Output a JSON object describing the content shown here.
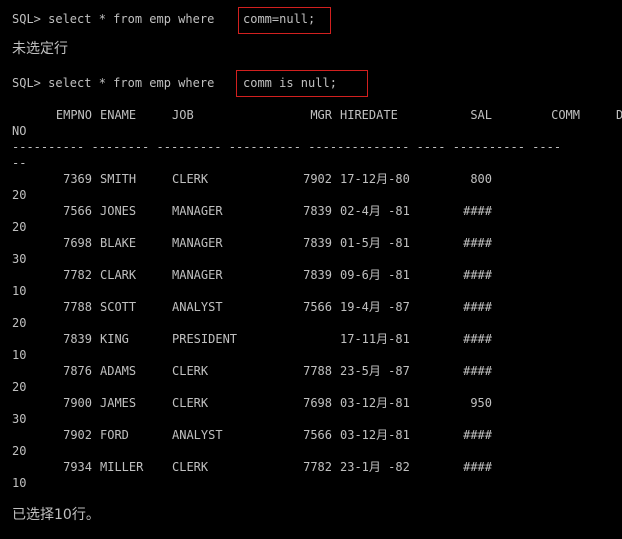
{
  "session": {
    "query1_prefix": "SQL> select * from emp where ",
    "query1_highlight": "comm=null;",
    "result1": "未选定行",
    "query2_prefix": "SQL> select * from emp where ",
    "query2_highlight": "comm is null;",
    "headers": {
      "empno": "EMPNO",
      "ename": "ENAME",
      "job": "JOB",
      "mgr": "MGR",
      "hiredate": "HIREDATE",
      "sal": "SAL",
      "comm": "COMM",
      "deptno_cont": "NO"
    },
    "dash_line": "---------- -------- --------- ---------- -------------- ---- ---------- ----",
    "dash_cont": "--",
    "rows": [
      {
        "empno": "7369",
        "ename": "SMITH",
        "job": "CLERK",
        "mgr": "7902",
        "hiredate": "17-12月-80",
        "sal": "800",
        "deptno": "20"
      },
      {
        "empno": "7566",
        "ename": "JONES",
        "job": "MANAGER",
        "mgr": "7839",
        "hiredate": "02-4月 -81",
        "sal": "####",
        "deptno": "20"
      },
      {
        "empno": "7698",
        "ename": "BLAKE",
        "job": "MANAGER",
        "mgr": "7839",
        "hiredate": "01-5月 -81",
        "sal": "####",
        "deptno": "30"
      },
      {
        "empno": "7782",
        "ename": "CLARK",
        "job": "MANAGER",
        "mgr": "7839",
        "hiredate": "09-6月 -81",
        "sal": "####",
        "deptno": "10"
      },
      {
        "empno": "7788",
        "ename": "SCOTT",
        "job": "ANALYST",
        "mgr": "7566",
        "hiredate": "19-4月 -87",
        "sal": "####",
        "deptno": "20"
      },
      {
        "empno": "7839",
        "ename": "KING",
        "job": "PRESIDENT",
        "mgr": "",
        "hiredate": "17-11月-81",
        "sal": "####",
        "deptno": "10"
      },
      {
        "empno": "7876",
        "ename": "ADAMS",
        "job": "CLERK",
        "mgr": "7788",
        "hiredate": "23-5月 -87",
        "sal": "####",
        "deptno": "20"
      },
      {
        "empno": "7900",
        "ename": "JAMES",
        "job": "CLERK",
        "mgr": "7698",
        "hiredate": "03-12月-81",
        "sal": "950",
        "deptno": "30"
      },
      {
        "empno": "7902",
        "ename": "FORD",
        "job": "ANALYST",
        "mgr": "7566",
        "hiredate": "03-12月-81",
        "sal": "####",
        "deptno": "20"
      },
      {
        "empno": "7934",
        "ename": "MILLER",
        "job": "CLERK",
        "mgr": "7782",
        "hiredate": "23-1月 -82",
        "sal": "####",
        "deptno": "10"
      }
    ],
    "footer": "已选择10行。"
  },
  "colors": {
    "background": "#000000",
    "text": "#c0c0c0",
    "highlight_border": "#d2201f"
  }
}
